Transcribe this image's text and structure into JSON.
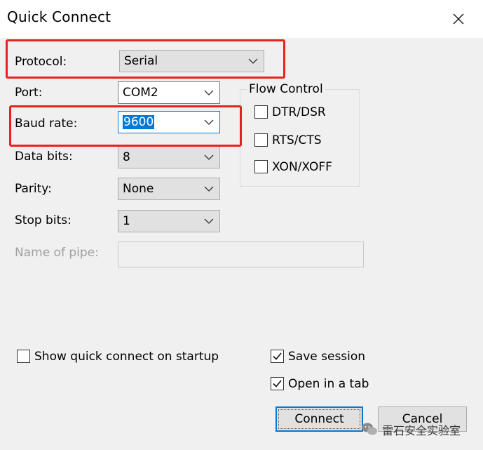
{
  "window": {
    "title": "Quick Connect"
  },
  "fields": {
    "protocol": {
      "label": "Protocol:",
      "value": "Serial"
    },
    "port": {
      "label": "Port:",
      "value": "COM2"
    },
    "baud_rate": {
      "label": "Baud rate:",
      "value": "9600"
    },
    "data_bits": {
      "label": "Data bits:",
      "value": "8"
    },
    "parity": {
      "label": "Parity:",
      "value": "None"
    },
    "stop_bits": {
      "label": "Stop bits:",
      "value": "1"
    },
    "name_of_pipe": {
      "label": "Name of pipe:",
      "value": ""
    }
  },
  "flow_control": {
    "title": "Flow Control",
    "options": [
      {
        "label": "DTR/DSR",
        "checked": false
      },
      {
        "label": "RTS/CTS",
        "checked": false
      },
      {
        "label": "XON/XOFF",
        "checked": false
      }
    ]
  },
  "options": {
    "show_quick_connect": {
      "label": "Show quick connect on startup",
      "checked": false
    },
    "save_session": {
      "label": "Save session",
      "checked": true
    },
    "open_in_tab": {
      "label": "Open in a tab",
      "checked": true
    }
  },
  "buttons": {
    "connect": "Connect",
    "cancel": "Cancel"
  },
  "watermark": {
    "text": "雷石安全实验室"
  },
  "colors": {
    "highlight": "#e8231d",
    "selection": "#0078d7"
  }
}
